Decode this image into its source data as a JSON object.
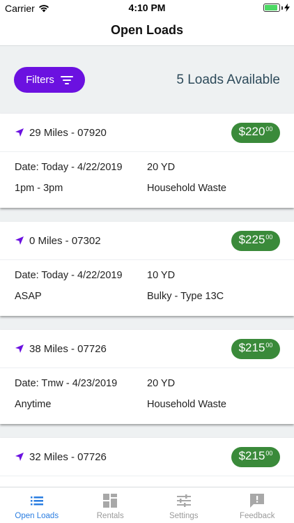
{
  "status_bar": {
    "carrier": "Carrier",
    "time": "4:10 PM",
    "battery_level": 0.9
  },
  "nav": {
    "title": "Open Loads"
  },
  "filters": {
    "button_label": "Filters",
    "count_label": "5 Loads Available"
  },
  "colors": {
    "accent": "#6b11e0",
    "price_green": "#3a8a3a",
    "tab_active": "#2a7de1"
  },
  "loads": [
    {
      "distance": "29 Miles - 07920",
      "price": "$220",
      "cents": "00",
      "date": "Date: Today - 4/22/2019",
      "size": "20 YD",
      "time": "1pm - 3pm",
      "type": "Household Waste"
    },
    {
      "distance": "0 Miles - 07302",
      "price": "$225",
      "cents": "00",
      "date": "Date: Today - 4/22/2019",
      "size": "10 YD",
      "time": "ASAP",
      "type": "Bulky - Type 13C"
    },
    {
      "distance": "38 Miles - 07726",
      "price": "$215",
      "cents": "00",
      "date": "Date: Tmw - 4/23/2019",
      "size": "20 YD",
      "time": "Anytime",
      "type": "Household Waste"
    },
    {
      "distance": "32 Miles - 07726",
      "price": "$215",
      "cents": "00",
      "date": "",
      "size": "",
      "time": "",
      "type": ""
    }
  ],
  "tabs": [
    {
      "label": "Open Loads",
      "icon": "list-icon"
    },
    {
      "label": "Rentals",
      "icon": "grid-icon"
    },
    {
      "label": "Settings",
      "icon": "sliders-icon"
    },
    {
      "label": "Feedback",
      "icon": "feedback-icon"
    }
  ]
}
